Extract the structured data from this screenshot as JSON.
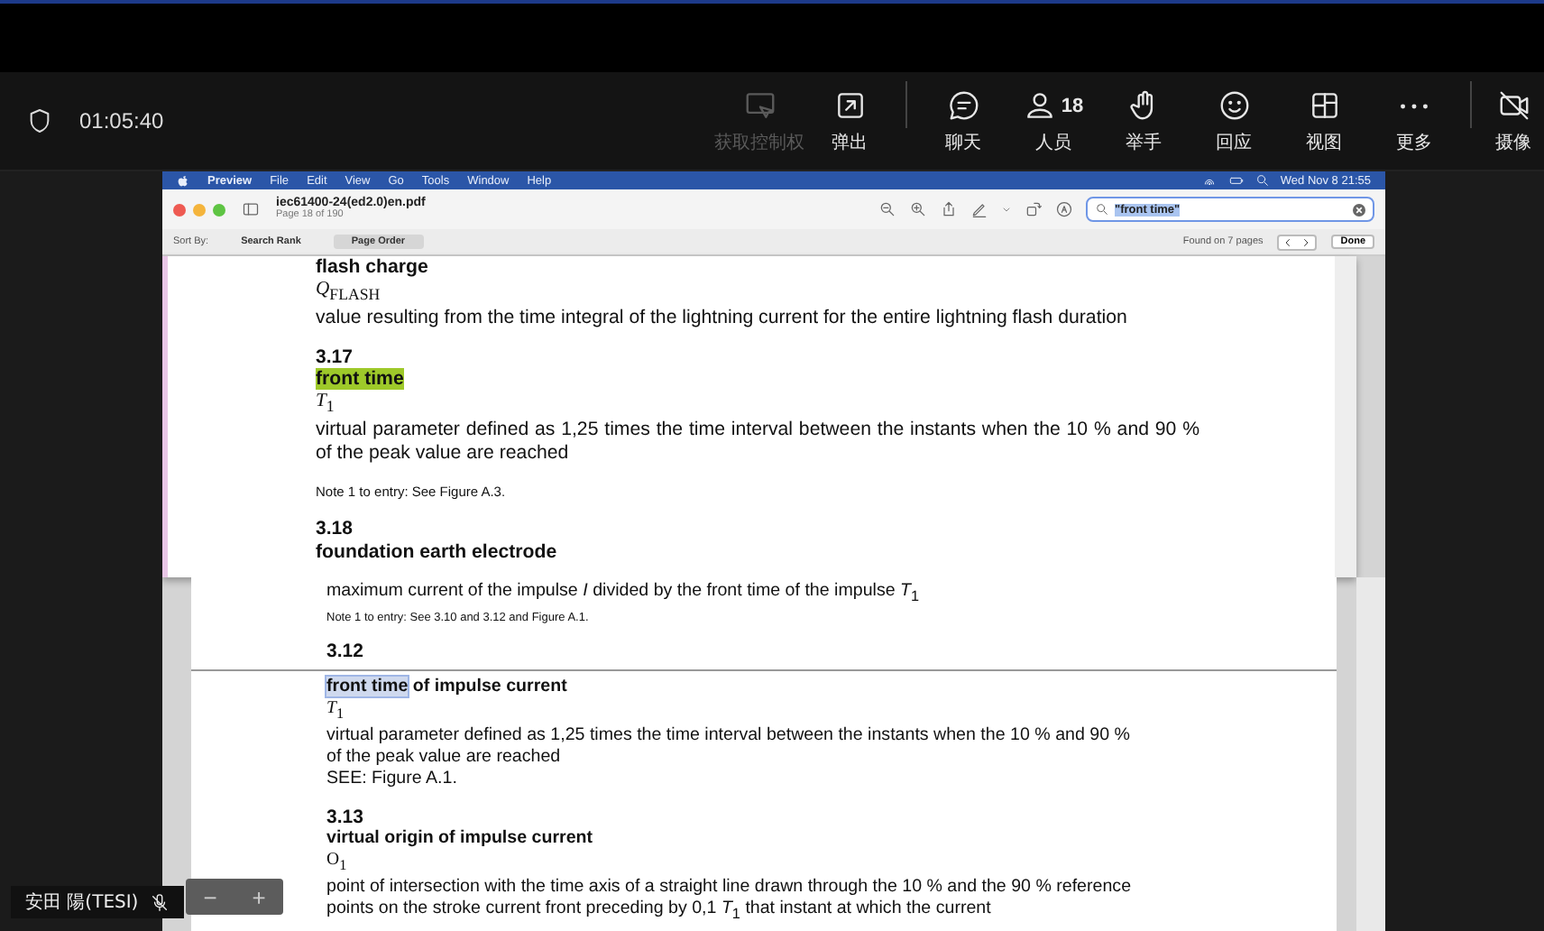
{
  "top_bar": {
    "timer": "01:05:40"
  },
  "meeting_controls": [
    {
      "kind": "control",
      "label": "获取控制权",
      "disabled": true
    },
    {
      "kind": "popout",
      "label": "弹出",
      "disabled": false
    },
    {
      "kind": "chat",
      "label": "聊天",
      "disabled": false
    },
    {
      "kind": "people",
      "label": "人员",
      "count": "18",
      "disabled": false
    },
    {
      "kind": "hand",
      "label": "举手",
      "disabled": false
    },
    {
      "kind": "react",
      "label": "回应",
      "disabled": false
    },
    {
      "kind": "view",
      "label": "视图",
      "disabled": false
    },
    {
      "kind": "more",
      "label": "更多",
      "disabled": false
    }
  ],
  "camera_button": {
    "label": "摄像"
  },
  "mac_menubar": {
    "menus": [
      "Preview",
      "File",
      "Edit",
      "View",
      "Go",
      "Tools",
      "Window",
      "Help"
    ],
    "clock": "Wed Nov 8  21:55"
  },
  "preview_window": {
    "file_name": "iec61400-24(ed2.0)en.pdf",
    "page_info": "Page 18 of 190",
    "search": {
      "value": "\"front time\""
    },
    "sort_label": "Sort By:",
    "sort_options": [
      {
        "label": "Search Rank",
        "selected": false
      },
      {
        "label": "Page Order",
        "selected": true
      }
    ],
    "found": "Found on 7 pages",
    "done": "Done"
  },
  "search_result": {
    "blocks": [
      {
        "kind": "term",
        "segments": [
          {
            "text": "flash charge",
            "search_match": false,
            "selected": false
          }
        ]
      },
      {
        "kind": "symbol",
        "text": "*Q*$_{FLASH}$"
      },
      {
        "kind": "para",
        "text": "value resulting from the time integral of the lightning current for the entire lightning flash duration"
      },
      {
        "kind": "number",
        "text": "3.17"
      },
      {
        "kind": "term",
        "segments": [
          {
            "text": "front time",
            "search_match": true,
            "selected": false
          }
        ]
      },
      {
        "kind": "symbol",
        "text": "*T*$_{1}$"
      },
      {
        "kind": "para",
        "text": "virtual parameter defined as 1,25 times the time interval between the instants when the 10 % and 90 % of the peak value are reached"
      },
      {
        "kind": "note",
        "text": "Note 1 to entry:   See Figure A.3."
      },
      {
        "kind": "number",
        "text": "3.18"
      },
      {
        "kind": "term",
        "segments": [
          {
            "text": "foundation earth electrode",
            "search_match": false,
            "selected": false
          }
        ]
      }
    ]
  },
  "document": {
    "blocks": [
      {
        "kind": "para",
        "text": "maximum current of the impulse *I* divided by the front time of the impulse *T*$_{1}$"
      },
      {
        "kind": "note",
        "text": "Note 1 to entry: See 3.10 and 3.12 and Figure A.1."
      },
      {
        "kind": "number",
        "text": "3.12"
      },
      {
        "kind": "divider"
      },
      {
        "kind": "term",
        "segments": [
          {
            "text": "front time",
            "search_match": false,
            "selected": true
          },
          {
            "text": " of impulse current",
            "search_match": false,
            "selected": false
          }
        ]
      },
      {
        "kind": "symbol",
        "text": "*T*$_{1}$"
      },
      {
        "kind": "para",
        "text": "virtual parameter defined as 1,25 times the time interval between the instants when the 10 %  and 90 % of the peak value are reached"
      },
      {
        "kind": "para",
        "text": "SEE: Figure A.1."
      },
      {
        "kind": "number",
        "text": "3.13"
      },
      {
        "kind": "term",
        "segments": [
          {
            "text": "virtual origin of impulse current",
            "search_match": false,
            "selected": false
          }
        ]
      },
      {
        "kind": "symbol",
        "text": "O$_{1}$"
      },
      {
        "kind": "para",
        "text": "point of intersection with the time axis of a straight line drawn through the 10 % and the 90 % reference points on the stroke current front preceding by 0,1 *T*$_{1}$ that instant at which the current"
      }
    ]
  },
  "participant": {
    "name": "安田 陽(TESI)",
    "muted": true
  },
  "zoom_controls": [
    "−",
    "+"
  ]
}
